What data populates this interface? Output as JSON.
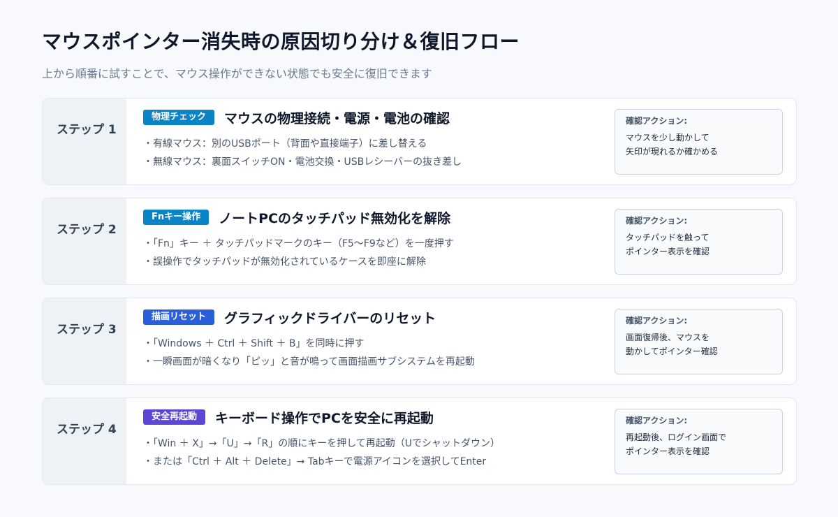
{
  "header": {
    "title": "マウスポインター消失時の原因切り分け＆復旧フロー",
    "subtitle": "上から順番に試すことで、マウス操作ができない状態でも安全に復旧できます"
  },
  "action_label": "確認アクション:",
  "steps": [
    {
      "label": "ステップ 1",
      "badge": "物理チェック",
      "badge_color": "#0a84c6",
      "title": "マウスの物理接続・電源・電池の確認",
      "bullets": [
        "・有線マウス：別のUSBポート（背面や直接端子）に差し替える",
        "・無線マウス：裏面スイッチON・電池交換・USBレシーバーの抜き差し"
      ],
      "action_lines": [
        "マウスを少し動かして",
        "矢印が現れるか確かめる"
      ]
    },
    {
      "label": "ステップ 2",
      "badge": "Fnキー操作",
      "badge_color": "#0a84c6",
      "title": "ノートPCのタッチパッド無効化を解除",
      "bullets": [
        "・「Fn」キー ＋ タッチパッドマークのキー（F5〜F9など）を一度押す",
        "・誤操作でタッチパッドが無効化されているケースを即座に解除"
      ],
      "action_lines": [
        "タッチパッドを触って",
        "ポインター表示を確認"
      ]
    },
    {
      "label": "ステップ 3",
      "badge": "描画リセット",
      "badge_color": "#2b5fd9",
      "title": "グラフィックドライバーのリセット",
      "bullets": [
        "・「Windows ＋ Ctrl ＋ Shift ＋ B」を同時に押す",
        "・一瞬画面が暗くなり「ピッ」と音が鳴って画面描画サブシステムを再起動"
      ],
      "action_lines": [
        "画面復帰後、マウスを",
        "動かしてポインター確認"
      ]
    },
    {
      "label": "ステップ 4",
      "badge": "安全再起動",
      "badge_color": "#5b46d6",
      "title": "キーボード操作でPCを安全に再起動",
      "bullets": [
        "・「Win ＋ X」→「U」→「R」の順にキーを押して再起動（Uでシャットダウン）",
        "・または「Ctrl ＋ Alt ＋ Delete」→ Tabキーで電源アイコンを選択してEnter"
      ],
      "action_lines": [
        "再起動後、ログイン画面で",
        "ポインター表示を確認"
      ]
    }
  ]
}
